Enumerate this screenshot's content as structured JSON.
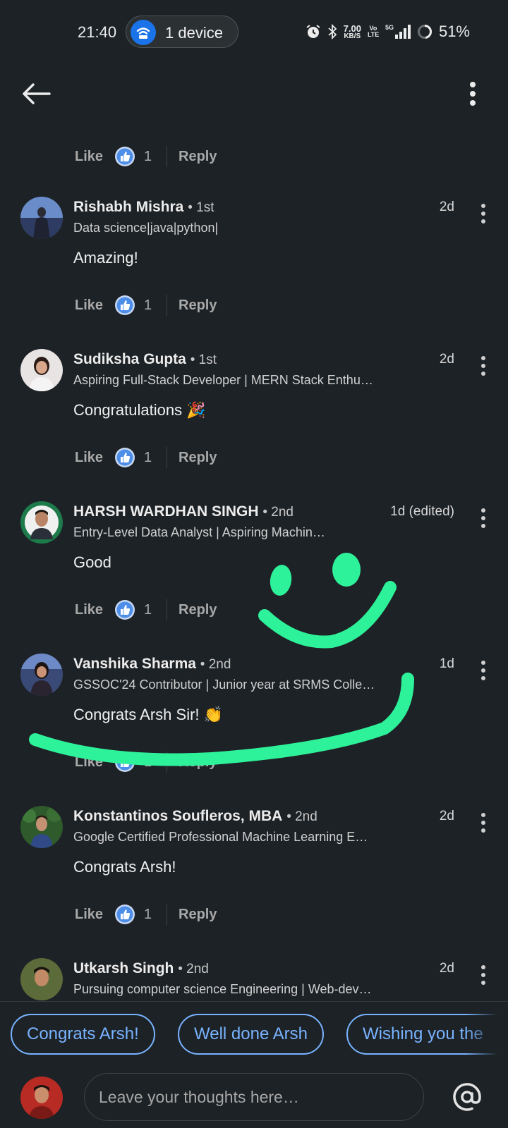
{
  "status_bar": {
    "time": "21:40",
    "hotspot_label": "1 device",
    "net_speed_value": "7.00",
    "net_speed_unit": "KB/S",
    "volte": "Vo LTE",
    "network": "5G",
    "battery": "51%"
  },
  "feed": {
    "top_action": {
      "like_label": "Like",
      "count": "1",
      "reply_label": "Reply"
    },
    "comments": [
      {
        "name": "Rishabh Mishra",
        "degree": "• 1st",
        "time": "2d",
        "headline": "Data science|java|python|",
        "text": "Amazing!",
        "like_label": "Like",
        "count": "1",
        "reply_label": "Reply"
      },
      {
        "name": "Sudiksha Gupta",
        "degree": "• 1st",
        "time": "2d",
        "headline": "Aspiring Full-Stack Developer | MERN Stack Enthu…",
        "text": "Congratulations 🎉",
        "like_label": "Like",
        "count": "1",
        "reply_label": "Reply"
      },
      {
        "name": "HARSH WARDHAN SINGH",
        "degree": "• 2nd",
        "time": "1d (edited)",
        "headline": "Entry-Level Data Analyst | Aspiring Machin…",
        "text": "Good",
        "like_label": "Like",
        "count": "1",
        "reply_label": "Reply"
      },
      {
        "name": "Vanshika Sharma",
        "degree": "• 2nd",
        "time": "1d",
        "headline": "GSSOC'24 Contributor | Junior year at SRMS Colle…",
        "text": "Congrats Arsh Sir! 👏",
        "like_label": "Like",
        "count": "1",
        "reply_label": "Reply"
      },
      {
        "name": "Konstantinos Soufleros, MBA",
        "degree": "• 2nd",
        "time": "2d",
        "headline": "Google Certified Professional Machine Learning E…",
        "text": "Congrats Arsh!",
        "like_label": "Like",
        "count": "1",
        "reply_label": "Reply"
      },
      {
        "name": "Utkarsh Singh",
        "degree": "• 2nd",
        "time": "2d",
        "headline": "Pursuing computer science Engineering | Web-dev…",
        "text": "",
        "like_label": "",
        "count": "",
        "reply_label": ""
      }
    ]
  },
  "suggestions": [
    "Congrats Arsh!",
    "Well done Arsh",
    "Wishing you the"
  ],
  "composer": {
    "placeholder": "Leave your thoughts here…"
  },
  "colors": {
    "background": "#1d2226",
    "accent": "#78b3ff",
    "like_badge": "#4d8ee8",
    "doodle": "#2ef29a"
  }
}
